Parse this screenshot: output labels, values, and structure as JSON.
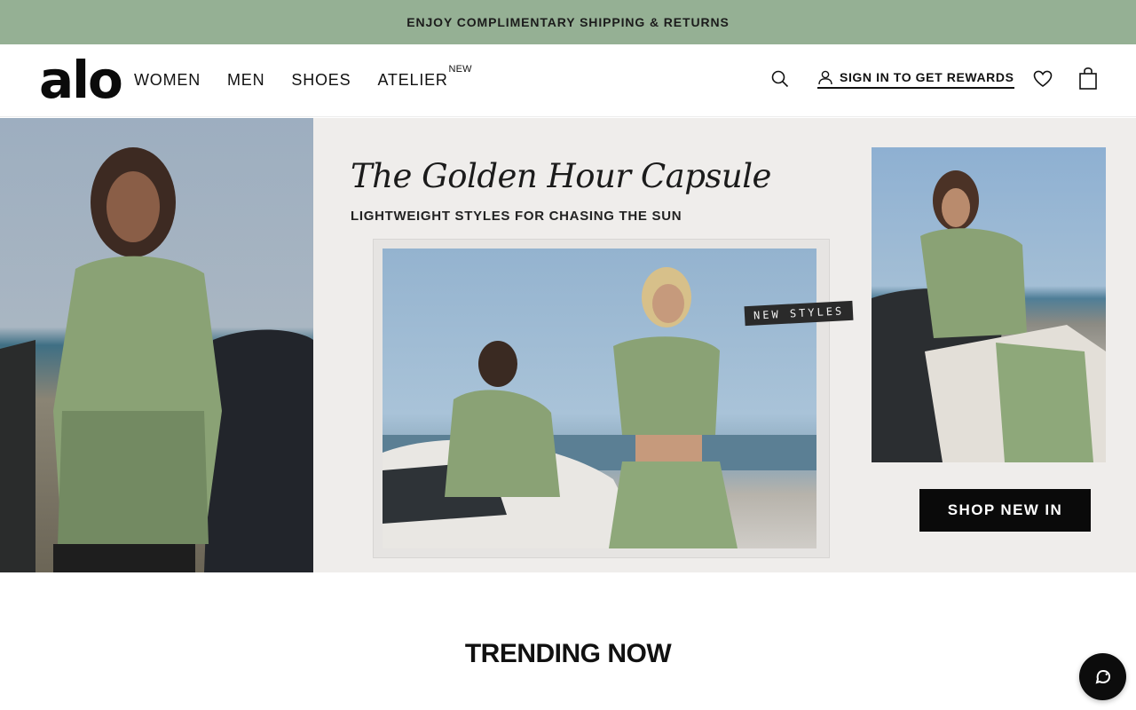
{
  "promo": {
    "text": "ENJOY COMPLIMENTARY SHIPPING & RETURNS"
  },
  "header": {
    "logo": "alo",
    "nav": [
      {
        "label": "WOMEN"
      },
      {
        "label": "MEN"
      },
      {
        "label": "SHOES"
      },
      {
        "label": "ATELIER",
        "badge": "NEW"
      }
    ],
    "signin_label": "SIGN IN TO GET REWARDS",
    "icons": [
      "search-icon",
      "user-icon",
      "heart-icon",
      "bag-icon"
    ]
  },
  "hero": {
    "title": "The Golden Hour Capsule",
    "subtitle": "LIGHTWEIGHT STYLES FOR CHASING THE SUN",
    "tag": "NEW STYLES",
    "cta": "SHOP NEW IN"
  },
  "section": {
    "title": "TRENDING NOW"
  },
  "chat": {
    "icon": "chat-icon"
  },
  "colors": {
    "promo_bg": "#95b094",
    "outfit_green": "#8aa275",
    "cta_bg": "#0a0a0a",
    "hero_bg": "#efedeb"
  }
}
